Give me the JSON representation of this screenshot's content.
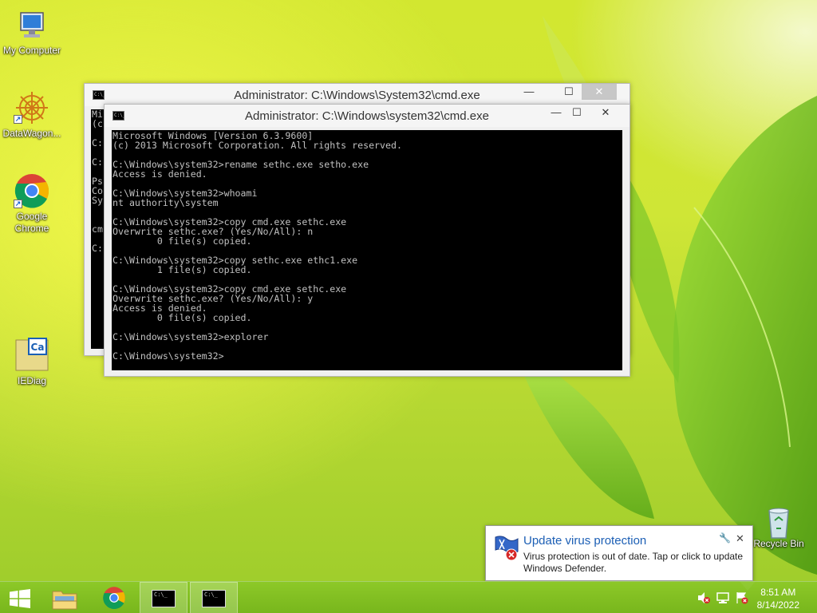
{
  "desktop": {
    "icons": [
      {
        "label": "My Computer"
      },
      {
        "label": "DataWagon..."
      },
      {
        "label": "Google Chrome"
      },
      {
        "label": "IEDiag"
      },
      {
        "label": "Recycle Bin"
      }
    ]
  },
  "window_back": {
    "title": "Administrator: C:\\Windows\\System32\\cmd.exe",
    "visible_lines": "Mi\n(c\n\nC:\n\nC:\n\nPs\nCo\nSy\n\n\ncm\n\nC:"
  },
  "window_front": {
    "title": "Administrator: C:\\Windows\\system32\\cmd.exe",
    "console_text": "Microsoft Windows [Version 6.3.9600]\n(c) 2013 Microsoft Corporation. All rights reserved.\n\nC:\\Windows\\system32>rename sethc.exe setho.exe\nAccess is denied.\n\nC:\\Windows\\system32>whoami\nnt authority\\system\n\nC:\\Windows\\system32>copy cmd.exe sethc.exe\nOverwrite sethc.exe? (Yes/No/All): n\n        0 file(s) copied.\n\nC:\\Windows\\system32>copy sethc.exe ethc1.exe\n        1 file(s) copied.\n\nC:\\Windows\\system32>copy cmd.exe sethc.exe\nOverwrite sethc.exe? (Yes/No/All): y\nAccess is denied.\n        0 file(s) copied.\n\nC:\\Windows\\system32>explorer\n\nC:\\Windows\\system32>"
  },
  "controls": {
    "minimize": "—",
    "maximize": "☐",
    "close": "✕"
  },
  "cmd_icon_text": "C:\\_",
  "notification": {
    "title": "Update virus protection",
    "body": "Virus protection is out of date. Tap or click to update Windows Defender."
  },
  "taskbar": {
    "clock": {
      "time": "8:51 AM",
      "date": "8/14/2022"
    },
    "items": [
      "start",
      "file-explorer",
      "google-chrome",
      "cmd-window-1",
      "cmd-window-2"
    ]
  },
  "colors": {
    "console_bg": "#000000",
    "console_text": "#c0c0c0",
    "toast_title": "#1c5fb5",
    "taskbar": "#7ab81f"
  }
}
